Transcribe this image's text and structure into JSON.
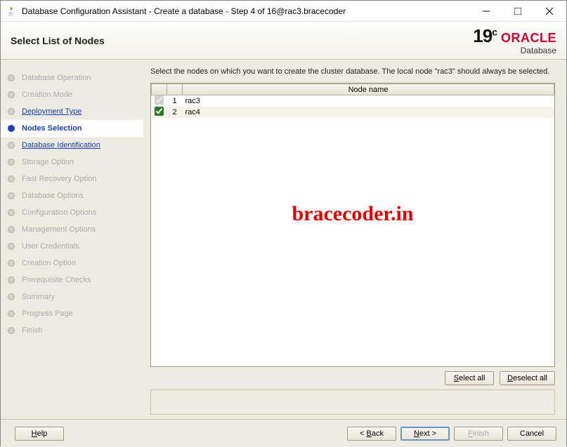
{
  "window": {
    "title": "Database Configuration Assistant - Create a database - Step 4 of 16@rac3.bracecoder"
  },
  "header": {
    "page_title": "Select List of Nodes",
    "brand_version": "19",
    "brand_version_sup": "c",
    "brand_name": "ORACLE",
    "brand_sub": "Database"
  },
  "sidebar": {
    "items": [
      {
        "label": "Database Operation",
        "state": "disabled"
      },
      {
        "label": "Creation Mode",
        "state": "disabled"
      },
      {
        "label": "Deployment Type",
        "state": "done"
      },
      {
        "label": "Nodes Selection",
        "state": "current"
      },
      {
        "label": "Database Identification",
        "state": "next"
      },
      {
        "label": "Storage Option",
        "state": "disabled"
      },
      {
        "label": "Fast Recovery Option",
        "state": "disabled"
      },
      {
        "label": "Database Options",
        "state": "disabled"
      },
      {
        "label": "Configuration Options",
        "state": "disabled"
      },
      {
        "label": "Management Options",
        "state": "disabled"
      },
      {
        "label": "User Credentials",
        "state": "disabled"
      },
      {
        "label": "Creation Option",
        "state": "disabled"
      },
      {
        "label": "Prerequisite Checks",
        "state": "disabled"
      },
      {
        "label": "Summary",
        "state": "disabled"
      },
      {
        "label": "Progress Page",
        "state": "disabled"
      },
      {
        "label": "Finish",
        "state": "disabled"
      }
    ]
  },
  "main": {
    "instruction": "Select the nodes on which you want to create the cluster database. The local node \"rac3\" should always be selected.",
    "table": {
      "header": "Node name",
      "rows": [
        {
          "idx": "1",
          "name": "rac3",
          "checked": true,
          "locked": true
        },
        {
          "idx": "2",
          "name": "rac4",
          "checked": true,
          "locked": false
        }
      ]
    },
    "buttons": {
      "select_all": "Select all",
      "deselect_all": "Deselect all"
    },
    "watermark": "bracecoder.in"
  },
  "footer": {
    "help": "Help",
    "back": "< Back",
    "next": "Next >",
    "finish": "Finish",
    "cancel": "Cancel"
  }
}
